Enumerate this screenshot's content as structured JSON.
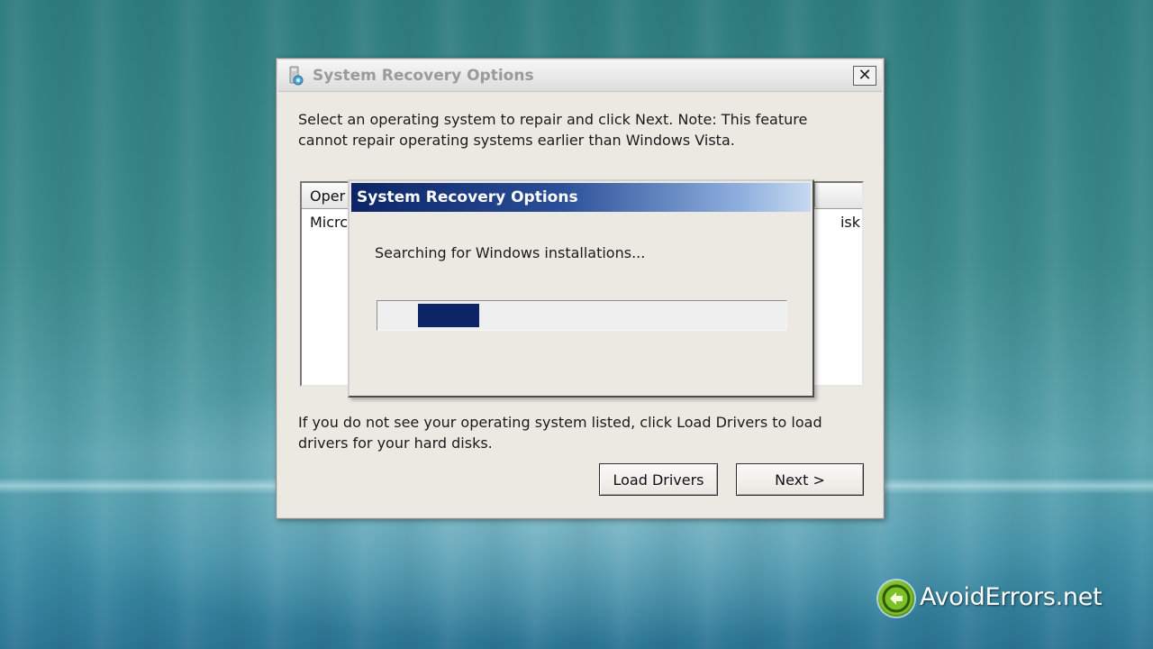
{
  "background": {
    "colors": {
      "top": "#2f7d7f",
      "horizon": "#bfe6ec",
      "bottom": "#2c7594"
    }
  },
  "main_dialog": {
    "title": "System Recovery Options",
    "close_glyph": "✕",
    "instruction": "Select an operating system to repair and click Next. Note: This feature cannot repair operating systems earlier than Windows Vista.",
    "os_list": {
      "columns": [
        "Oper",
        "",
        ""
      ],
      "rows": [
        [
          "Micrc",
          "",
          "isk"
        ]
      ]
    },
    "footer_text": "If you do not see your operating system listed, click Load Drivers to load drivers for your hard disks.",
    "buttons": {
      "load_drivers": "Load Drivers",
      "next": "Next >"
    }
  },
  "progress_dialog": {
    "title": "System Recovery Options",
    "message": "Searching for Windows installations...",
    "progress": {
      "mode": "marquee",
      "block_start_fraction": 0.1,
      "block_width_fraction": 0.15,
      "color": "#0d2467"
    }
  },
  "watermark": {
    "text": "AvoidErrors.net",
    "icon": "avoiderrors-logo-icon"
  }
}
